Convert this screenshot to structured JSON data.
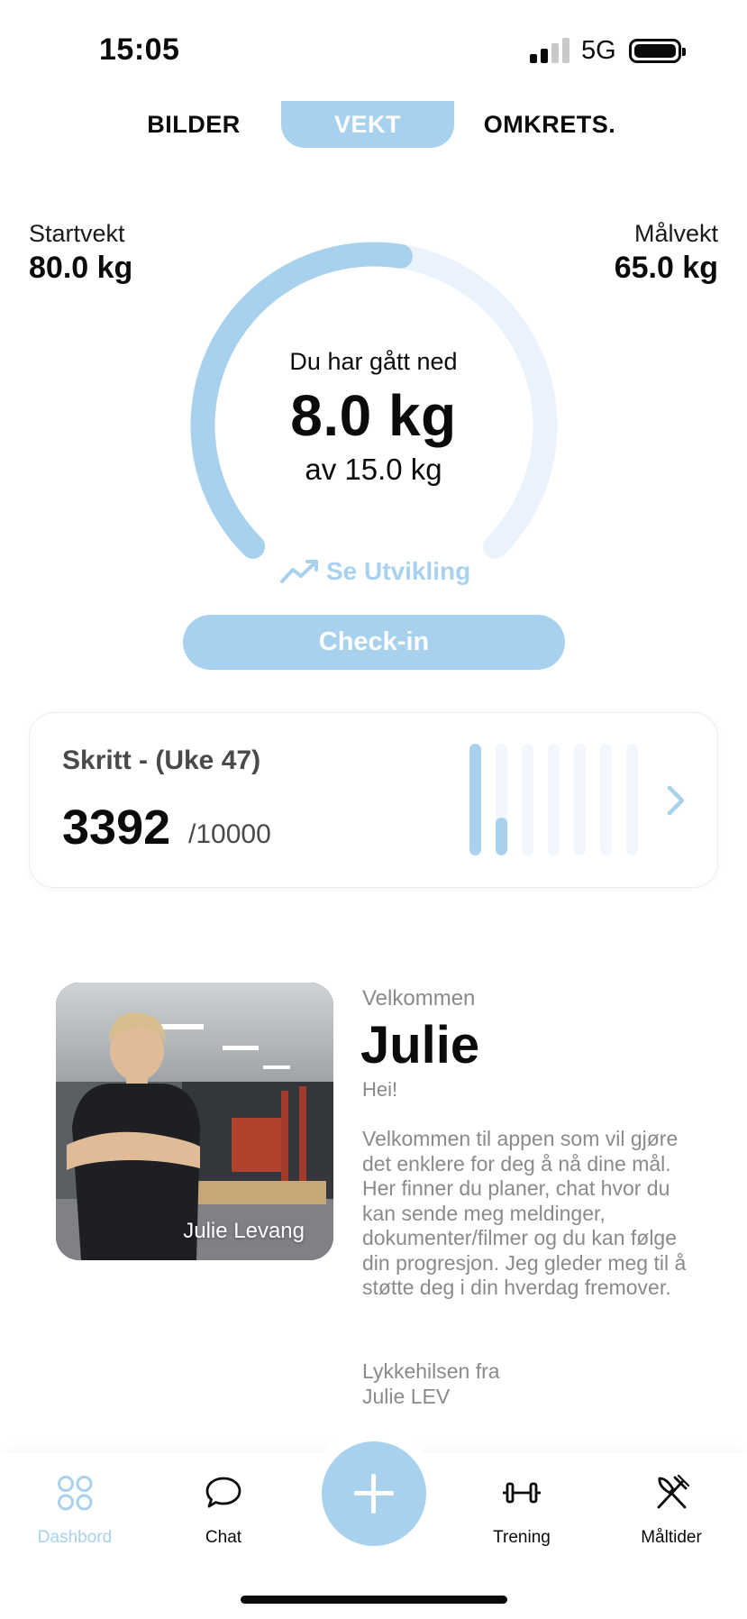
{
  "status_bar": {
    "time": "15:05",
    "network": "5G"
  },
  "tabs": [
    {
      "label": "BILDER",
      "active": false
    },
    {
      "label": "VEKT",
      "active": true
    },
    {
      "label": "OMKRETS.",
      "active": false
    }
  ],
  "weight": {
    "start_label": "Startvekt",
    "start_value": "80.0 kg",
    "goal_label": "Målvekt",
    "goal_value": "65.0 kg",
    "lost_label": "Du har gått ned",
    "lost_value": "8.0 kg",
    "lost_of": "av 15.0 kg",
    "progress_fraction": 0.533,
    "progress_color": "#a8d1ee",
    "track_color": "#eaf3fb"
  },
  "development_link": "Se Utvikling",
  "checkin_button": "Check-in",
  "steps": {
    "title": "Skritt - (Uke 47)",
    "value": "3392",
    "goal": "/10000",
    "daily_fractions": [
      1.0,
      0.34,
      0,
      0,
      0,
      0,
      0
    ]
  },
  "welcome": {
    "label": "Velkommen",
    "name": "Julie",
    "greeting": "Hei!",
    "body": "Velkommen til appen som vil gjøre det enklere for deg å nå dine mål. Her finner du planer, chat hvor du kan sende meg meldinger, dokumenter/filmer og du kan følge din progresjon. Jeg gleder meg til å støtte deg i din hverdag fremover.",
    "signature_line1": "Lykkehilsen fra",
    "signature_line2": "Julie LEV",
    "photo_caption": "Julie Levang"
  },
  "nav": {
    "dashboard": "Dashbord",
    "chat": "Chat",
    "training": "Trening",
    "meals": "Måltider",
    "accent": "#a8d1ee"
  }
}
